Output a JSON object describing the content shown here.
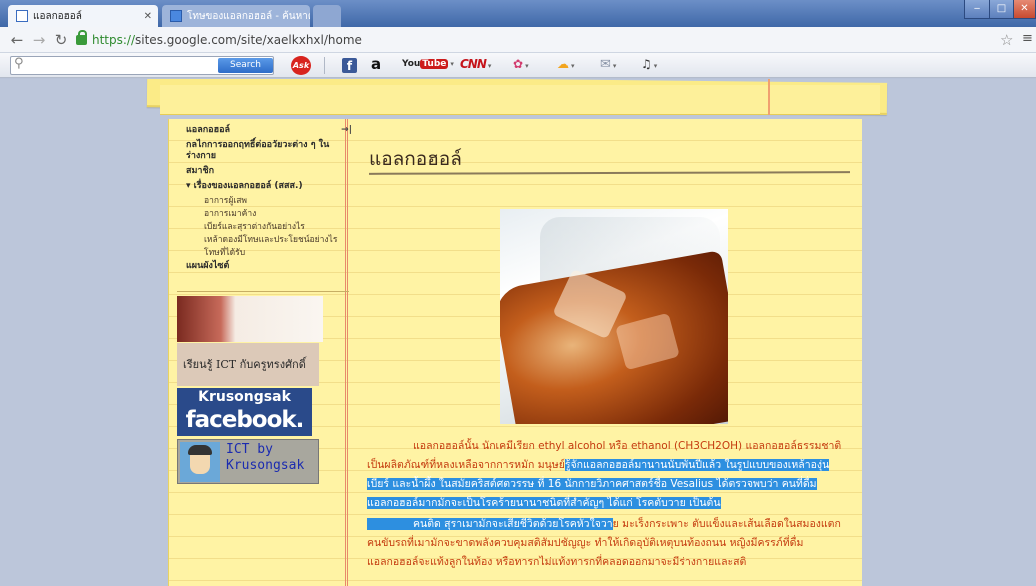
{
  "tabs": [
    {
      "label": "แอลกอฮอล์",
      "active": true
    },
    {
      "label": "โทษของแอลกอฮอล์ - ค้นหาด้",
      "active": false
    }
  ],
  "window_controls": {
    "minimize": "‒",
    "maximize": "□",
    "close": "✕"
  },
  "address_bar": {
    "scheme": "https://",
    "url": "sites.google.com/site/xaelkxhxl/home"
  },
  "toolbar": {
    "search_placeholder": "",
    "search_button": "Search",
    "icons": [
      "ask-icon",
      "facebook-icon",
      "amazon-icon",
      "youtube-icon",
      "cnn-icon",
      "flower-icon",
      "weather-icon",
      "mail-icon",
      "radio-icon"
    ],
    "ask_label": "Ask",
    "fb_label": "f",
    "amazon_label": "a",
    "youtube_label": "You",
    "youtube_tube": "Tube",
    "cnn_label": "CNN"
  },
  "sidebar": {
    "items": [
      {
        "label": "แอลกอฮอล์"
      },
      {
        "label": "กลไกการออกฤทธิ์ต่ออวัยวะต่าง ๆ ในร่างกาย"
      },
      {
        "label": "สมาชิก"
      },
      {
        "label": "▾ เรื่องของแอลกอฮอล์ (สสส.)"
      },
      {
        "label": "แผนผังไซต์"
      }
    ],
    "subitems": [
      "อาการผู้เสพ",
      "อาการเมาค้าง",
      "เบียร์และสุราต่างกันอย่างไร",
      "เหล้าดองมีโทษและประโยชน์อย่างไร",
      "โทษที่ได้รับ"
    ],
    "arrow": "→|",
    "banner_ict": "เรียนรู้ ICT กับครูทรงศักดิ์",
    "banner_fb_name": "Krusongsak",
    "banner_fb_word": "facebook.",
    "banner_avatar_text": "ICT by\nKrusongsak",
    "banner_flowers_caption": ""
  },
  "main": {
    "title": "แอลกอฮอล์",
    "body_p1a": "แอลกอฮอล์นั้น นักเคมีเรียก ethyl alcohol หรือ ethanol (CH3CH2OH) แอลกอฮอล์ธรรมชาติเป็นผลิตภัณฑ์ที่หลงเหลือจากการหมัก มนุษย์",
    "body_p1b": "รู้จักแอลกอฮอล์มานานนับพันปีแล้ว ในรูปแบบของเหล้าองุ่น เบียร์ และน้ำผึ้ง ในสมัยคริสต์ศตวรรษ ที่ 16 นักกายวิภาคศาสตร์ชื่อ Vesalius ได้ตรวจพบว่า คนที่ดื่มแอลกอฮอล์มากมักจะเป็นโรคร้ายนานาชนิดที่สำคัญๆ ได้แก่ โรคตับวาย เป็นต้น",
    "body_p2a": "คนติด สุราเมามักจะเสียชีวิตด้วยโรคหัวใจวา",
    "body_p2b": "ย มะเร็งกระเพาะ ตับแข็งและเส้นเลือดในสมองแตก คนขับรถที่เมามักจะขาดพลังควบคุมสติสัมปชัญญะ ทำให้เกิดอุบัติเหตุบนท้องถนน หญิงมีครรภ์ที่ดื่มแอลกอฮอล์จะแท้งลูกในท้อง หรือทารกไม่แท้งทารกที่คลอดออกมาจะมีร่างกายและสติ"
  },
  "colors": {
    "paper": "#fff3a4",
    "body_text": "#c43a0e",
    "highlight": "#2d8fe0"
  }
}
